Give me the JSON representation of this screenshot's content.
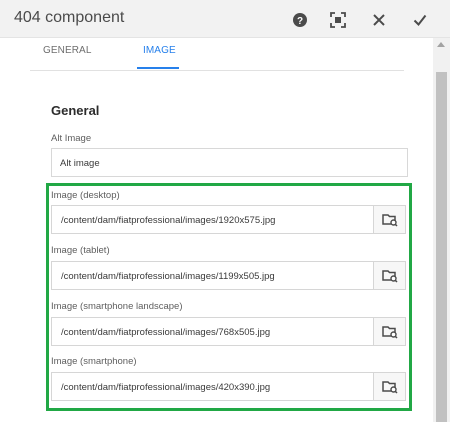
{
  "dialog": {
    "title": "404 component",
    "help_icon": "help-icon",
    "fullscreen_icon": "fullscreen-icon",
    "close_icon": "close-icon",
    "done_icon": "checkmark-icon"
  },
  "tabs": [
    {
      "label": "GENERAL",
      "active": false
    },
    {
      "label": "IMAGE",
      "active": true
    }
  ],
  "section": {
    "title": "General"
  },
  "alt_image": {
    "label": "Alt Image",
    "value": "Alt image"
  },
  "image_fields": [
    {
      "label": "Image (desktop)",
      "value": "/content/dam/fiatprofessional/images/1920x575.jpg"
    },
    {
      "label": "Image (tablet)",
      "value": "/content/dam/fiatprofessional/images/1199x505.jpg"
    },
    {
      "label": "Image (smartphone landscape)",
      "value": "/content/dam/fiatprofessional/images/768x505.jpg"
    },
    {
      "label": "Image (smartphone)",
      "value": "/content/dam/fiatprofessional/images/420x390.jpg"
    }
  ],
  "colors": {
    "accent": "#2680eb",
    "highlight": "#21a845"
  }
}
